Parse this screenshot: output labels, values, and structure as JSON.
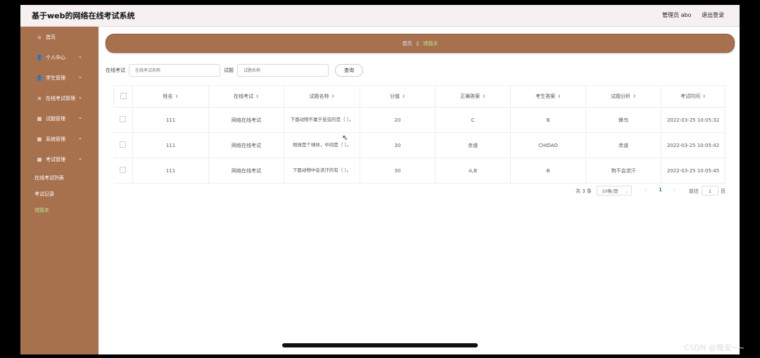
{
  "header": {
    "title": "基于web的网络在线考试系统",
    "user": "管理员 abo",
    "logout": "退出登录"
  },
  "sidebar": {
    "items": [
      {
        "label": "首页",
        "icon": "home-icon",
        "glyph": "⌂",
        "has_sub": false
      },
      {
        "label": "个人中心",
        "icon": "user-icon",
        "glyph": "👤",
        "has_sub": true
      },
      {
        "label": "学生管理",
        "icon": "user-icon",
        "glyph": "👤",
        "has_sub": true
      },
      {
        "label": "在线考试管理",
        "icon": "list-icon",
        "glyph": "≡",
        "has_sub": true
      },
      {
        "label": "试题管理",
        "icon": "grid-icon",
        "glyph": "▦",
        "has_sub": true
      },
      {
        "label": "系统管理",
        "icon": "grid-icon",
        "glyph": "▦",
        "has_sub": true
      },
      {
        "label": "考试管理",
        "icon": "grid-icon",
        "glyph": "▦",
        "has_sub": true
      }
    ],
    "subitems": [
      {
        "label": "在线考试列表",
        "active": false
      },
      {
        "label": "考试记录",
        "active": false
      },
      {
        "label": "错题本",
        "active": true
      }
    ]
  },
  "breadcrumb": {
    "home": "首页",
    "separator": "▯",
    "current": "错题本"
  },
  "search": {
    "exam_label": "在线考试",
    "exam_placeholder": "在线考试名称",
    "question_label": "试题",
    "question_placeholder": "试题名称",
    "button": "查询"
  },
  "table": {
    "columns": [
      "姓名",
      "在线考试",
      "试题名称",
      "分值",
      "正确答案",
      "考生答案",
      "试题分析",
      "考试时间"
    ],
    "rows": [
      {
        "name": "111",
        "exam": "网络在线考试",
        "question": "下面动物不属于昆虫的是（ ）。",
        "score": "20",
        "correct": "C",
        "answer": "B",
        "analysis": "蜂鸟",
        "time": "2022-03-25 10:05:32"
      },
      {
        "name": "111",
        "exam": "网络在线考试",
        "question": "地球是个球体，中间是（ ）。",
        "score": "30",
        "correct": "赤道",
        "answer": "CHIDAO",
        "analysis": "赤道",
        "time": "2022-03-25 10:05:42"
      },
      {
        "name": "111",
        "exam": "网络在线考试",
        "question": "下面动物中会流汗的有（ ）。",
        "score": "30",
        "correct": "A,B",
        "answer": "B",
        "analysis": "狗不会流汗",
        "time": "2022-03-25 10:05:45"
      }
    ]
  },
  "pagination": {
    "total": "共 3 条",
    "page_size": "10条/页",
    "prev": "‹",
    "current_page": "1",
    "next": "›",
    "goto_label": "前往",
    "goto_value": "1",
    "page_unit": "页"
  },
  "watermark": "CSDN @晚安~~",
  "colors": {
    "sidebar": "#a8714e",
    "accent_active": "#b6e08a",
    "current_page": "#2e8b57"
  }
}
